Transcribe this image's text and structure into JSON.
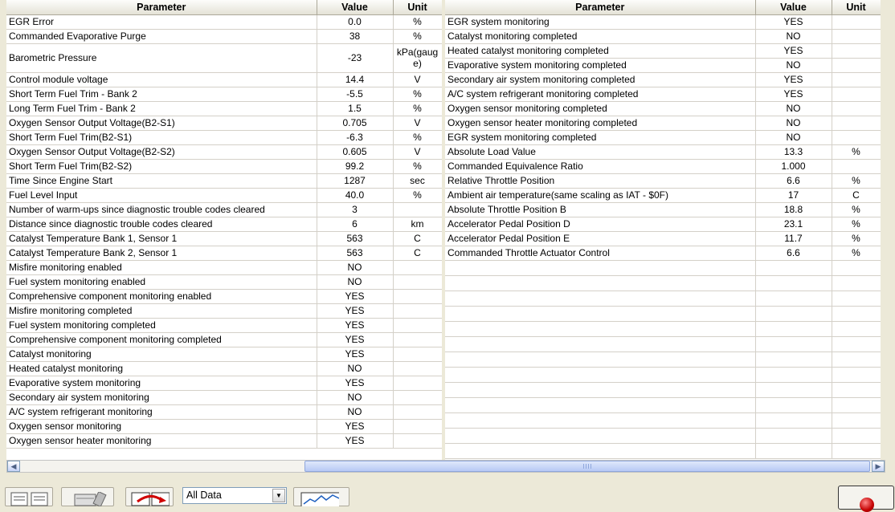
{
  "columns": {
    "parameter": "Parameter",
    "value": "Value",
    "unit": "Unit"
  },
  "left_rows": [
    {
      "p": "EGR Error",
      "v": "0.0",
      "u": "%"
    },
    {
      "p": "Commanded Evaporative Purge",
      "v": "38",
      "u": "%"
    },
    {
      "p": "Barometric Pressure",
      "v": "-23",
      "u": "kPa(gauge)"
    },
    {
      "p": "Control module voltage",
      "v": "14.4",
      "u": "V"
    },
    {
      "p": "Short Term Fuel Trim - Bank 2",
      "v": "-5.5",
      "u": "%"
    },
    {
      "p": "Long Term Fuel Trim - Bank 2",
      "v": "1.5",
      "u": "%"
    },
    {
      "p": "Oxygen Sensor Output Voltage(B2-S1)",
      "v": "0.705",
      "u": "V"
    },
    {
      "p": "Short Term Fuel Trim(B2-S1)",
      "v": "-6.3",
      "u": "%"
    },
    {
      "p": "Oxygen Sensor Output Voltage(B2-S2)",
      "v": "0.605",
      "u": "V"
    },
    {
      "p": "Short Term Fuel Trim(B2-S2)",
      "v": "99.2",
      "u": "%"
    },
    {
      "p": "Time Since Engine Start",
      "v": "1287",
      "u": "sec"
    },
    {
      "p": "Fuel Level Input",
      "v": "40.0",
      "u": "%"
    },
    {
      "p": "Number of warm-ups since diagnostic trouble codes cleared",
      "v": "3",
      "u": ""
    },
    {
      "p": "Distance since diagnostic trouble codes cleared",
      "v": "6",
      "u": "km"
    },
    {
      "p": "Catalyst Temperature Bank 1, Sensor 1",
      "v": "563",
      "u": "C"
    },
    {
      "p": "Catalyst Temperature Bank 2, Sensor 1",
      "v": "563",
      "u": "C"
    },
    {
      "p": "Misfire monitoring enabled",
      "v": "NO",
      "u": ""
    },
    {
      "p": "Fuel system monitoring enabled",
      "v": "NO",
      "u": ""
    },
    {
      "p": "Comprehensive component monitoring enabled",
      "v": "YES",
      "u": ""
    },
    {
      "p": "Misfire monitoring completed",
      "v": "YES",
      "u": ""
    },
    {
      "p": "Fuel system monitoring completed",
      "v": "YES",
      "u": ""
    },
    {
      "p": "Comprehensive component monitoring completed",
      "v": "YES",
      "u": ""
    },
    {
      "p": "Catalyst monitoring",
      "v": "YES",
      "u": ""
    },
    {
      "p": "Heated catalyst monitoring",
      "v": "NO",
      "u": ""
    },
    {
      "p": "Evaporative system monitoring",
      "v": "YES",
      "u": ""
    },
    {
      "p": "Secondary air system monitoring",
      "v": "NO",
      "u": ""
    },
    {
      "p": "A/C system refrigerant monitoring",
      "v": "NO",
      "u": ""
    },
    {
      "p": "Oxygen sensor monitoring",
      "v": "YES",
      "u": ""
    },
    {
      "p": "Oxygen sensor heater monitoring",
      "v": "YES",
      "u": ""
    }
  ],
  "right_rows": [
    {
      "p": "EGR system monitoring",
      "v": "YES",
      "u": ""
    },
    {
      "p": "Catalyst monitoring completed",
      "v": "NO",
      "u": ""
    },
    {
      "p": "Heated catalyst monitoring completed",
      "v": "YES",
      "u": ""
    },
    {
      "p": "Evaporative system monitoring completed",
      "v": "NO",
      "u": ""
    },
    {
      "p": "Secondary air system monitoring completed",
      "v": "YES",
      "u": ""
    },
    {
      "p": "A/C system refrigerant monitoring completed",
      "v": "YES",
      "u": ""
    },
    {
      "p": "Oxygen sensor monitoring completed",
      "v": "NO",
      "u": ""
    },
    {
      "p": "Oxygen sensor heater monitoring completed",
      "v": "NO",
      "u": ""
    },
    {
      "p": "EGR system monitoring completed",
      "v": "NO",
      "u": ""
    },
    {
      "p": "Absolute Load Value",
      "v": "13.3",
      "u": "%"
    },
    {
      "p": "Commanded Equivalence Ratio",
      "v": "1.000",
      "u": ""
    },
    {
      "p": "Relative Throttle Position",
      "v": "6.6",
      "u": "%"
    },
    {
      "p": "Ambient air temperature(same scaling as IAT - $0F)",
      "v": "17",
      "u": "C"
    },
    {
      "p": "Absolute Throttle Position B",
      "v": "18.8",
      "u": "%"
    },
    {
      "p": "Accelerator Pedal Position D",
      "v": "23.1",
      "u": "%"
    },
    {
      "p": "Accelerator Pedal Position E",
      "v": "11.7",
      "u": "%"
    },
    {
      "p": "Commanded Throttle Actuator Control",
      "v": "6.6",
      "u": "%"
    }
  ],
  "toolbar": {
    "filter_selected": "All Data",
    "icons": [
      "list-view-icon",
      "freeze-frame-icon",
      "record-icon",
      "graph-icon",
      "stop-icon"
    ]
  }
}
